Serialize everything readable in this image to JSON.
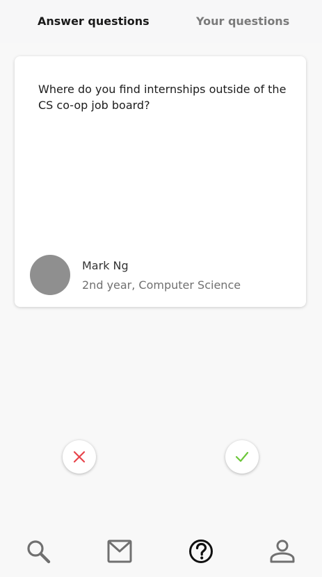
{
  "tabs": {
    "answer_label": "Answer questions",
    "yours_label": "Your questions",
    "active": "Answer questions"
  },
  "card": {
    "question": "Where do you find internships outside of the CS co-op job board?",
    "author_name": "Mark Ng",
    "author_meta": "2nd year, Computer Science"
  },
  "actions": {
    "reject_icon": "close-icon",
    "accept_icon": "checkmark-icon",
    "reject_color": "#e8434a",
    "accept_color": "#6cc63a"
  },
  "nav": {
    "items": [
      {
        "icon": "search-icon"
      },
      {
        "icon": "mail-icon"
      },
      {
        "icon": "help-icon",
        "active": true
      },
      {
        "icon": "profile-icon"
      }
    ],
    "inactive_color": "#707070",
    "active_color": "#111111"
  }
}
